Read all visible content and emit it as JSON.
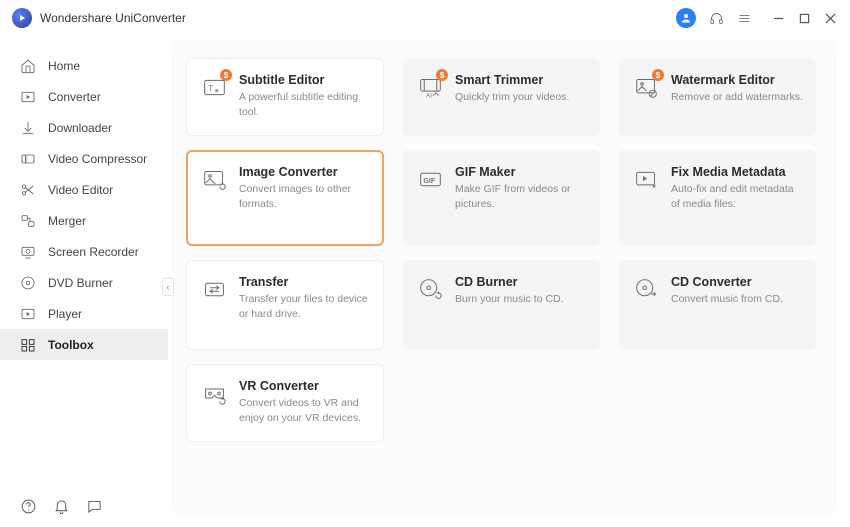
{
  "appTitle": "Wondershare UniConverter",
  "badge": "$",
  "sidebar": {
    "items": [
      {
        "label": "Home"
      },
      {
        "label": "Converter"
      },
      {
        "label": "Downloader"
      },
      {
        "label": "Video Compressor"
      },
      {
        "label": "Video Editor"
      },
      {
        "label": "Merger"
      },
      {
        "label": "Screen Recorder"
      },
      {
        "label": "DVD Burner"
      },
      {
        "label": "Player"
      },
      {
        "label": "Toolbox"
      }
    ]
  },
  "tools": [
    {
      "title": "Subtitle Editor",
      "desc": "A powerful subtitle editing tool."
    },
    {
      "title": "Smart Trimmer",
      "desc": "Quickly trim your videos."
    },
    {
      "title": "Watermark Editor",
      "desc": "Remove or add watermarks."
    },
    {
      "title": "Image Converter",
      "desc": "Convert images to other formats."
    },
    {
      "title": "GIF Maker",
      "desc": "Make GIF from videos or pictures."
    },
    {
      "title": "Fix Media Metadata",
      "desc": "Auto-fix and edit metadata of media files."
    },
    {
      "title": "Transfer",
      "desc": "Transfer your files to device or hard drive."
    },
    {
      "title": "CD Burner",
      "desc": "Burn your music to CD."
    },
    {
      "title": "CD Converter",
      "desc": "Convert music from CD."
    },
    {
      "title": "VR Converter",
      "desc": "Convert videos to VR and enjoy on your VR devices."
    }
  ]
}
